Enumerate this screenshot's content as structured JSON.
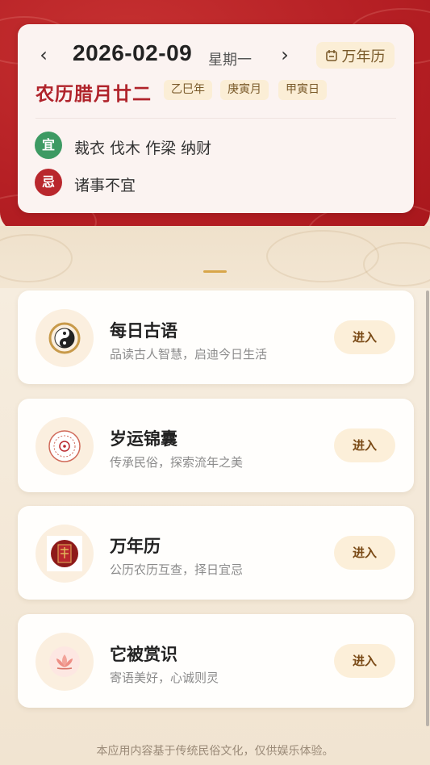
{
  "date_card": {
    "prev_symbol": "‹",
    "next_symbol": "›",
    "date": "2026-02-09",
    "weekday": "星期一",
    "calendar_chip_label": "万年历",
    "lunar_date": "农历腊月廿二",
    "ganzhi": [
      "乙巳年",
      "庚寅月",
      "甲寅日"
    ],
    "yi": {
      "badge": "宜",
      "text": "裁衣 伐木 作梁 纳财"
    },
    "ji": {
      "badge": "忌",
      "text": "诸事不宜"
    }
  },
  "features": [
    {
      "title": "每日古语",
      "subtitle": "品读古人智慧，启迪今日生活",
      "button": "进入",
      "icon": "yin-yang-icon"
    },
    {
      "title": "岁运锦囊",
      "subtitle": "传承民俗，探索流年之美",
      "button": "进入",
      "icon": "bagua-compass-icon"
    },
    {
      "title": "万年历",
      "subtitle": "公历农历互查，择日宜忌",
      "button": "进入",
      "icon": "almanac-book-icon"
    },
    {
      "title": "它被赏识",
      "subtitle": "寄语美好，心诚则灵",
      "button": "进入",
      "icon": "lotus-icon"
    }
  ],
  "footer": "本应用内容基于传统民俗文化，仅供娱乐体验。",
  "colors": {
    "brand_red": "#b51f24",
    "lunar_red": "#b0232b",
    "yi_green": "#3d9a63",
    "ji_red": "#b9272d",
    "chip_bg": "#fbeed6",
    "button_text": "#7a4a16"
  }
}
